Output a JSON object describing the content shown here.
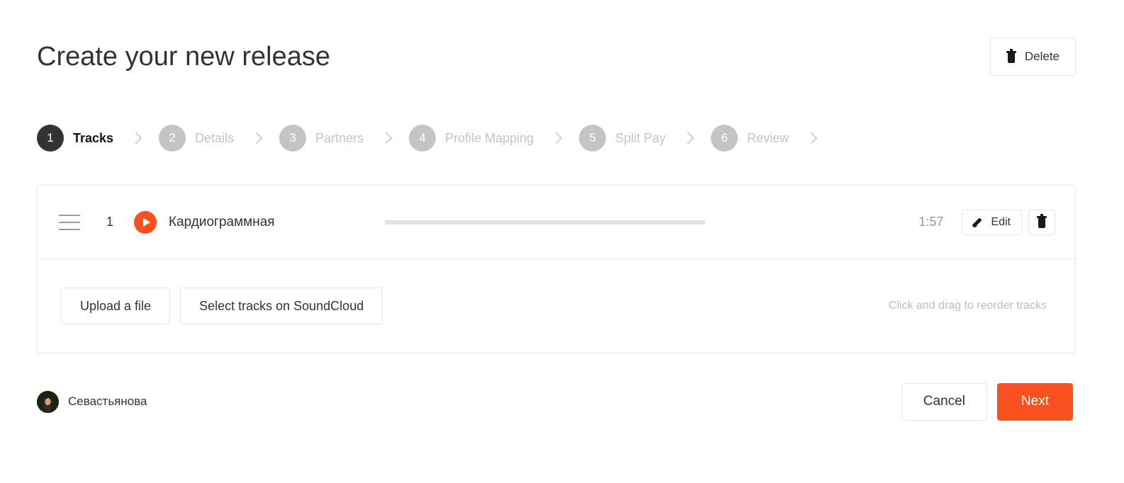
{
  "header": {
    "title": "Create your new release",
    "delete_label": "Delete",
    "delete_icon": "trash-icon"
  },
  "stepper": {
    "steps": [
      {
        "number": "1",
        "label": "Tracks",
        "state": "active"
      },
      {
        "number": "2",
        "label": "Details",
        "state": "inactive"
      },
      {
        "number": "3",
        "label": "Partners",
        "state": "inactive"
      },
      {
        "number": "4",
        "label": "Profile Mapping",
        "state": "inactive"
      },
      {
        "number": "5",
        "label": "Split Pay",
        "state": "inactive"
      },
      {
        "number": "6",
        "label": "Review",
        "state": "inactive"
      }
    ],
    "separator_icon": "chevron-right-icon"
  },
  "tracks": {
    "rows": [
      {
        "drag_icon": "drag-handle-icon",
        "index": "1",
        "play_icon": "play-icon",
        "title": "Кардиограммная",
        "duration": "1:57",
        "edit_label": "Edit",
        "edit_icon": "pencil-icon",
        "delete_icon": "trash-icon"
      }
    ],
    "upload_label": "Upload a file",
    "soundcloud_label": "Select tracks on SoundCloud",
    "reorder_hint": "Click and drag to reorder tracks"
  },
  "bottom": {
    "avatar_icon": "user-avatar",
    "username": "Севастьянова",
    "cancel_label": "Cancel",
    "next_label": "Next"
  },
  "colors": {
    "accent": "#F8501E",
    "active_step": "#333333",
    "inactive_step": "#C4C4C4",
    "border": "#E6E6E6",
    "muted_text": "#BDBDBD",
    "waveform": "#E3E3E3"
  }
}
